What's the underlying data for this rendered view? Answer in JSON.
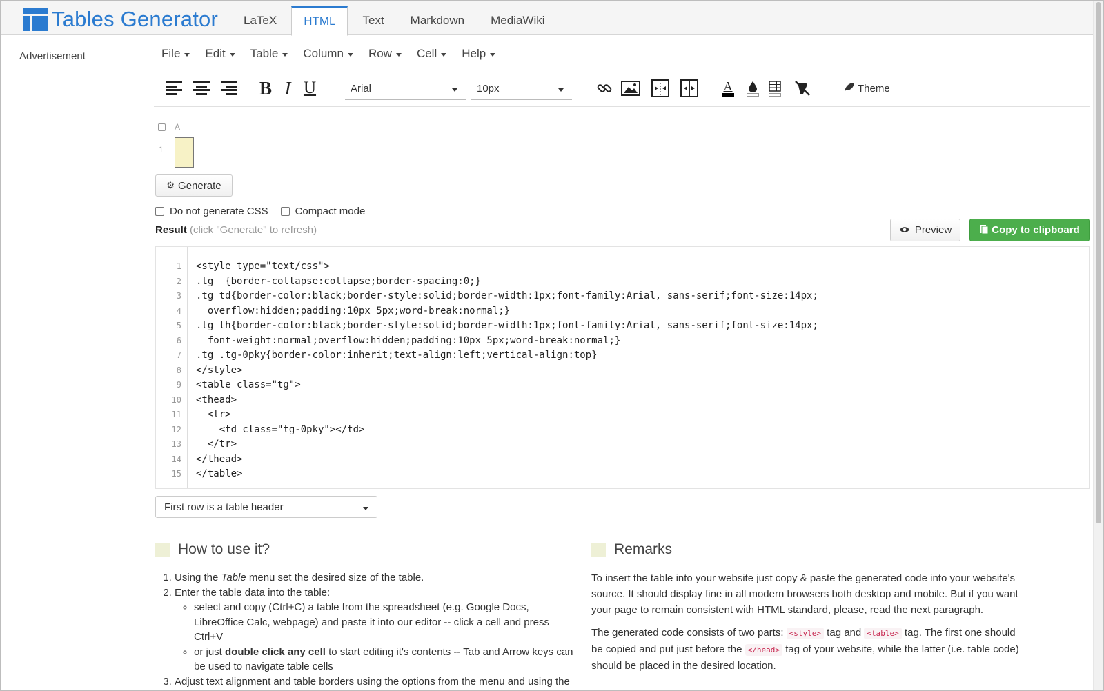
{
  "header": {
    "logo_text": "Tables Generator",
    "tabs": [
      {
        "label": "LaTeX",
        "active": false
      },
      {
        "label": "HTML",
        "active": true
      },
      {
        "label": "Text",
        "active": false
      },
      {
        "label": "Markdown",
        "active": false
      },
      {
        "label": "MediaWiki",
        "active": false
      }
    ]
  },
  "sidebar": {
    "advertisement": "Advertisement"
  },
  "menu": [
    "File",
    "Edit",
    "Table",
    "Column",
    "Row",
    "Cell",
    "Help"
  ],
  "toolbar": {
    "font_family": "Arial",
    "font_size": "10px",
    "bold": "B",
    "italic": "I",
    "underline": "U",
    "theme_label": "Theme",
    "text_color_glyph": "A"
  },
  "mini_table": {
    "column": "A",
    "row": "1"
  },
  "generate_button": "Generate",
  "options": {
    "no_css": "Do not generate CSS",
    "compact": "Compact mode"
  },
  "result": {
    "label": "Result",
    "hint": "(click \"Generate\" to refresh)"
  },
  "preview_button": "Preview",
  "copy_button": "Copy to clipboard",
  "code": {
    "line_numbers": [
      "1",
      "2",
      "3",
      "4",
      "5",
      "6",
      "7",
      "8",
      "9",
      "10",
      "11",
      "12",
      "13",
      "14",
      "15"
    ],
    "lines": [
      "<style type=\"text/css\">",
      ".tg  {border-collapse:collapse;border-spacing:0;}",
      ".tg td{border-color:black;border-style:solid;border-width:1px;font-family:Arial, sans-serif;font-size:14px;",
      "  overflow:hidden;padding:10px 5px;word-break:normal;}",
      ".tg th{border-color:black;border-style:solid;border-width:1px;font-family:Arial, sans-serif;font-size:14px;",
      "  font-weight:normal;overflow:hidden;padding:10px 5px;word-break:normal;}",
      ".tg .tg-0pky{border-color:inherit;text-align:left;vertical-align:top}",
      "</style>",
      "<table class=\"tg\">",
      "<thead>",
      "  <tr>",
      "    <td class=\"tg-0pky\"></td>",
      "  </tr>",
      "</thead>",
      "</table>"
    ]
  },
  "header_select": "First row is a table header",
  "howto": {
    "title": "How to use it?",
    "step1_pre": "Using the ",
    "step1_em": "Table",
    "step1_post": " menu set the desired size of the table.",
    "step2": "Enter the table data into the table:",
    "sub1": "select and copy (Ctrl+C) a table from the spreadsheet (e.g. Google Docs, LibreOffice Calc, webpage) and paste it into our editor -- click a cell and press Ctrl+V",
    "sub2_pre": "or just ",
    "sub2_bold": "double click any cell",
    "sub2_post": " to start editing it's contents -- Tab and Arrow keys can be used to navigate table cells",
    "step3": "Adjust text alignment and table borders using the options from the menu and using the"
  },
  "remarks": {
    "title": "Remarks",
    "p1": "To insert the table into your website just copy & paste the generated code into your website's source. It should display fine in all modern browsers both desktop and mobile. But if you want your page to remain consistent with HTML standard, please, read the next paragraph.",
    "p2_a": "The generated code consists of two parts: ",
    "tag_style": "<style>",
    "p2_b": " tag and ",
    "tag_table": "<table>",
    "p2_c": " tag. The first one should be copied and put just before the ",
    "tag_head": "</head>",
    "p2_d": " tag of your website, while the latter (i.e. table code) should be placed in the desired location."
  },
  "colors": {
    "brand": "#2b7bd0",
    "copy_green": "#4cae4c",
    "cell_yellow": "#f7f2c6",
    "code_tag": "#c7254e"
  }
}
